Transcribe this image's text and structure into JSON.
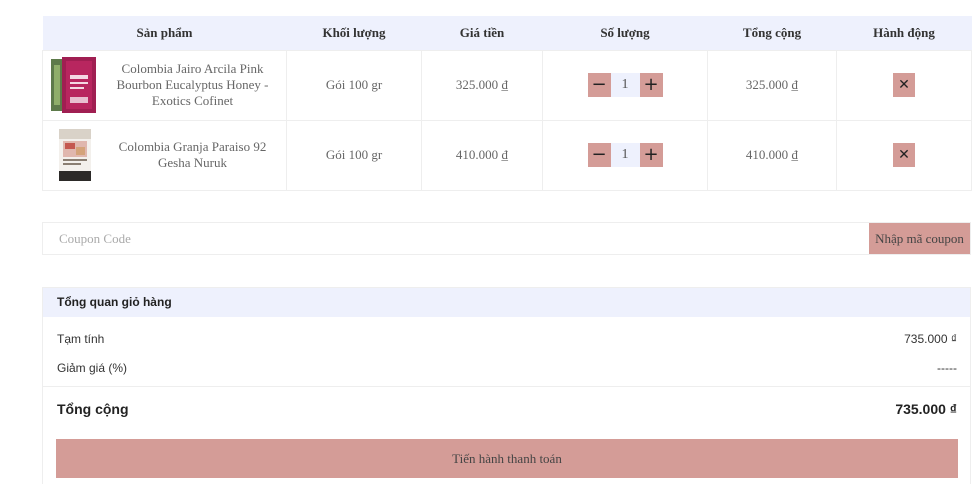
{
  "table": {
    "headers": [
      "Sản phẩm",
      "Khối lượng",
      "Giá tiền",
      "Số lượng",
      "Tổng cộng",
      "Hành động"
    ],
    "rows": [
      {
        "name": "Colombia Jairo Arcila Pink Bourbon Eucalyptus Honey - Exotics Cofinet",
        "weight": "Gói 100 gr",
        "price": "325.000 ₫",
        "quantity": "1",
        "total": "325.000 ₫"
      },
      {
        "name": "Colombia Granja Paraiso 92 Gesha Nuruk",
        "weight": "Gói 100 gr",
        "price": "410.000 ₫",
        "quantity": "1",
        "total": "410.000 ₫"
      }
    ],
    "minus_symbol": "−",
    "plus_symbol": "+",
    "remove_symbol": "✕"
  },
  "coupon": {
    "placeholder": "Coupon Code",
    "button_label": "Nhập mã coupon"
  },
  "summary": {
    "title": "Tổng quan giỏ hàng",
    "subtotal_label": "Tạm tính",
    "subtotal_value": "735.000 ₫",
    "discount_label": "Giảm giá (%)",
    "discount_value": "-----",
    "total_label": "Tổng cộng",
    "total_value": "735.000 ₫",
    "checkout_label": "Tiến hành thanh toán"
  },
  "colors": {
    "accent": "#d49c97",
    "header_bg": "#eef1fd"
  },
  "icons": [
    "coffee-bag-image-pink",
    "coffee-bag-image-white",
    "minus-icon",
    "plus-icon",
    "close-icon"
  ]
}
